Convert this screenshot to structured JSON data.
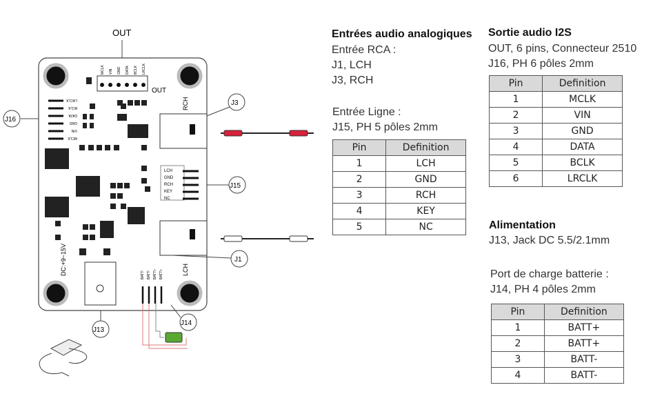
{
  "analog": {
    "title": "Entrées audio analogiques",
    "rca_label": "Entrée RCA :",
    "rca_lines": [
      "J1, LCH",
      "J3, RCH"
    ],
    "line_label": "Entrée Ligne :",
    "line_desc": "J15, PH 5 pôles 2mm",
    "table": {
      "headers": [
        "Pin",
        "Definition"
      ],
      "rows": [
        [
          "1",
          "LCH"
        ],
        [
          "2",
          "GND"
        ],
        [
          "3",
          "RCH"
        ],
        [
          "4",
          "KEY"
        ],
        [
          "5",
          "NC"
        ]
      ]
    }
  },
  "i2s": {
    "title": "Sortie audio I2S",
    "lines": [
      "OUT, 6 pins, Connecteur 2510",
      "J16, PH 6 pôles 2mm"
    ],
    "table": {
      "headers": [
        "Pin",
        "Definition"
      ],
      "rows": [
        [
          "1",
          "MCLK"
        ],
        [
          "2",
          "VIN"
        ],
        [
          "3",
          "GND"
        ],
        [
          "4",
          "DATA"
        ],
        [
          "5",
          "BCLK"
        ],
        [
          "6",
          "LRCLK"
        ]
      ]
    }
  },
  "power": {
    "title": "Alimentation",
    "desc": "J13, Jack DC 5.5/2.1mm"
  },
  "battery": {
    "title": "Port de charge batterie :",
    "desc": "J14, PH 4 pôles 2mm",
    "table": {
      "headers": [
        "Pin",
        "Definition"
      ],
      "rows": [
        [
          "1",
          "BATT+"
        ],
        [
          "2",
          "BATT+"
        ],
        [
          "3",
          "BATT-"
        ],
        [
          "4",
          "BATT-"
        ]
      ]
    }
  },
  "board": {
    "callouts": {
      "out": "OUT",
      "j16": "J16",
      "j3": "J3",
      "j15": "J15",
      "j1": "J1",
      "j13": "J13",
      "j14": "J14"
    },
    "silk": {
      "out": "OUT",
      "rch": "RCH",
      "lch": "LCH",
      "dc": "DC:+9~15V",
      "out_pins": [
        "MCLK",
        "VIN",
        "GND",
        "DATA",
        "BCLK",
        "LRCLK"
      ],
      "j16_pins": [
        "LRCLK",
        "BCLK",
        "DATA",
        "GND",
        "VIN",
        "MCLK"
      ],
      "j15_pins": [
        "LCH",
        "GND",
        "RCH",
        "KEY",
        "NC"
      ],
      "batt_pins": [
        "BATT-",
        "BATT-",
        "BATT+",
        "BATT+"
      ]
    },
    "colors": {
      "rca_right": "#d8213a",
      "battery": "#5aa832",
      "battery_wire": "#e07a7a"
    }
  }
}
